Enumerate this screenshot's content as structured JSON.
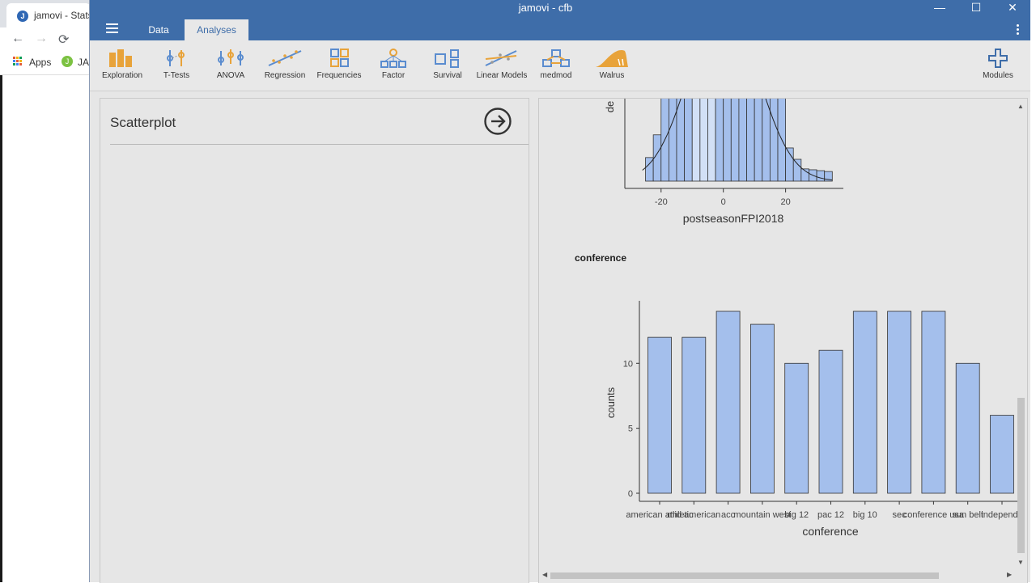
{
  "browser": {
    "tab_title": "jamovi - Stats.",
    "favicon_letter": "J",
    "bookmarks": {
      "apps_label": "Apps",
      "jasp_label": "JAS"
    }
  },
  "window": {
    "title": "jamovi - cfb",
    "controls": {
      "minimize": "—",
      "maximize": "☐",
      "close": "✕"
    }
  },
  "menu": {
    "tabs": [
      {
        "label": "Data",
        "active": false
      },
      {
        "label": "Analyses",
        "active": true
      }
    ]
  },
  "ribbon": {
    "items": [
      {
        "label": "Exploration",
        "icon": "exploration-icon"
      },
      {
        "label": "T-Tests",
        "icon": "t-tests-icon"
      },
      {
        "label": "ANOVA",
        "icon": "anova-icon"
      },
      {
        "label": "Regression",
        "icon": "regression-icon"
      },
      {
        "label": "Frequencies",
        "icon": "frequencies-icon"
      },
      {
        "label": "Factor",
        "icon": "factor-icon"
      },
      {
        "label": "Survival",
        "icon": "survival-icon"
      },
      {
        "label": "Linear Models",
        "icon": "linear-models-icon"
      },
      {
        "label": "medmod",
        "icon": "medmod-icon"
      },
      {
        "label": "Walrus",
        "icon": "walrus-icon"
      },
      {
        "label": "Modules",
        "icon": "plus-icon"
      }
    ]
  },
  "options_panel": {
    "title": "Scatterplot"
  },
  "results": {
    "section_heading": "conference",
    "histogram_ylabel_fragment": "de",
    "scroll_arrows": {
      "up": "▲",
      "down": "▼",
      "left": "◀",
      "right": "▶"
    }
  },
  "colors": {
    "title_bar": "#3e6da9",
    "accent_orange": "#e8a33a",
    "accent_blue": "#5a8ccf",
    "bar_fill": "#a4bfec",
    "ribbon_bg": "#e8e8e8",
    "panel_bg": "#e6e6e6"
  },
  "chart_data": [
    {
      "type": "bar",
      "title": "",
      "xlabel": "postseasonFPI2018",
      "ylabel": "de",
      "x_ticks": [
        -20,
        0,
        20
      ],
      "bin_edges": [
        -25,
        -22.5,
        -20,
        -17.5,
        -15,
        -12.5,
        -10,
        -7.5,
        -5,
        -2.5,
        0,
        2.5,
        5,
        7.5,
        10,
        12.5,
        15,
        17.5,
        20,
        22.5,
        25,
        27.5,
        30,
        32.5,
        35
      ],
      "relative_heights": [
        0.27,
        0.53,
        1.0,
        1.0,
        1.0,
        1.0,
        1.0,
        1.0,
        1.0,
        1.0,
        1.0,
        1.0,
        1.0,
        1.0,
        1.0,
        1.0,
        1.0,
        1.0,
        0.38,
        0.25,
        0.14,
        0.13,
        0.12,
        0.11
      ],
      "highlight_bins": [
        3,
        4,
        5,
        6,
        7,
        8,
        9,
        10,
        11,
        12,
        13,
        14,
        15,
        16,
        17
      ],
      "density_curve": true,
      "note": "histogram is clipped at the top by the scroll position"
    },
    {
      "type": "bar",
      "title": "conference",
      "xlabel": "conference",
      "ylabel": "counts",
      "categories": [
        "american athletic",
        "mid american",
        "acc",
        "mountain west",
        "big 12",
        "pac 12",
        "big 10",
        "sec",
        "conference usa",
        "sun belt",
        "independent"
      ],
      "x_tick_labels": [
        "american athletic",
        "mid american",
        "acc",
        "mountain west",
        "big 12",
        "pac 12",
        "big 10",
        "sec",
        "conference usa",
        "sun belt",
        "independe"
      ],
      "values": [
        12,
        12,
        14,
        13,
        10,
        11,
        14,
        14,
        14,
        10,
        6
      ],
      "y_ticks": [
        0,
        5,
        10
      ],
      "ylim": [
        0,
        14
      ]
    }
  ]
}
